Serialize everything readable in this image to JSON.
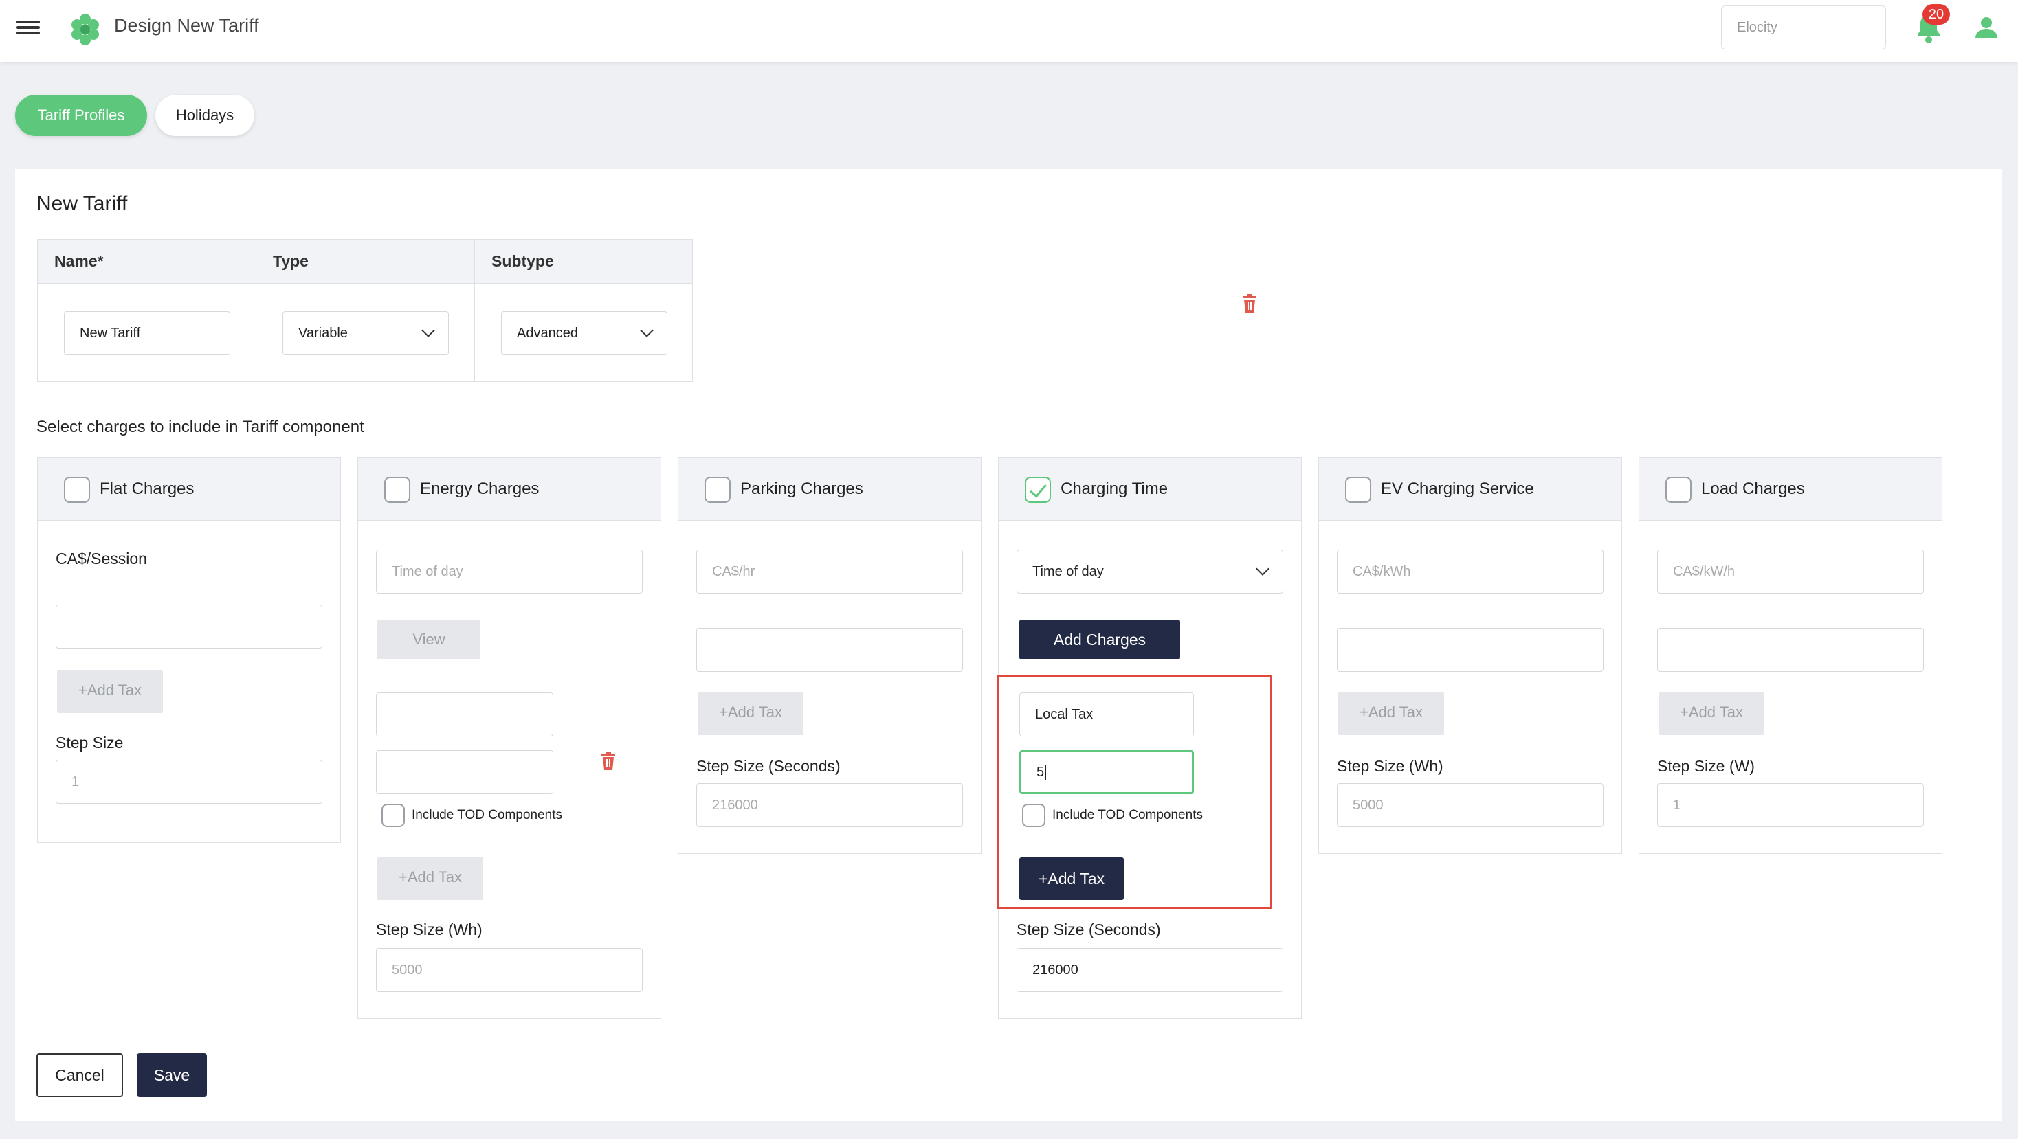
{
  "header": {
    "title": "Design New Tariff",
    "site_placeholder": "Elocity",
    "notifications_count": "20"
  },
  "tabs": {
    "tariff_profiles": "Tariff Profiles",
    "holidays": "Holidays"
  },
  "form": {
    "heading": "New Tariff",
    "columns": {
      "name": "Name*",
      "type": "Type",
      "subtype": "Subtype"
    },
    "name_value": "New Tariff",
    "type_value": "Variable",
    "subtype_value": "Advanced"
  },
  "charges_prompt": "Select charges to include in Tariff component",
  "panels": {
    "flat": {
      "title": "Flat Charges",
      "checked": false,
      "unit": "CA$/Session",
      "add_tax": "+Add Tax",
      "step_label": "Step Size",
      "step_value": "1"
    },
    "energy": {
      "title": "Energy Charges",
      "checked": false,
      "mode_placeholder": "Time of day",
      "view": "View",
      "tod_label": "Include TOD Components",
      "add_tax": "+Add Tax",
      "step_label": "Step Size (Wh)",
      "step_value": "5000"
    },
    "parking": {
      "title": "Parking Charges",
      "checked": false,
      "unit_placeholder": "CA$/hr",
      "add_tax": "+Add Tax",
      "step_label": "Step Size (Seconds)",
      "step_value": "216000"
    },
    "charging": {
      "title": "Charging Time",
      "checked": true,
      "mode_value": "Time of day",
      "add_charges": "Add Charges",
      "tax_name": "Local Tax",
      "tax_value": "5",
      "tod_label": "Include TOD Components",
      "add_tax": "+Add Tax",
      "step_label": "Step Size (Seconds)",
      "step_value": "216000"
    },
    "ev": {
      "title": "EV Charging Service",
      "checked": false,
      "unit_placeholder": "CA$/kWh",
      "add_tax": "+Add Tax",
      "step_label": "Step Size (Wh)",
      "step_value": "5000"
    },
    "load": {
      "title": "Load Charges",
      "checked": false,
      "unit_placeholder": "CA$/kW/h",
      "add_tax": "+Add Tax",
      "step_label": "Step Size (W)",
      "step_value": "1"
    }
  },
  "actions": {
    "cancel": "Cancel",
    "save": "Save"
  },
  "colors": {
    "accent_green": "#5dc87b",
    "dark_button": "#232a45",
    "highlight_red": "#e0483c",
    "trash_red": "#e05a4e"
  }
}
